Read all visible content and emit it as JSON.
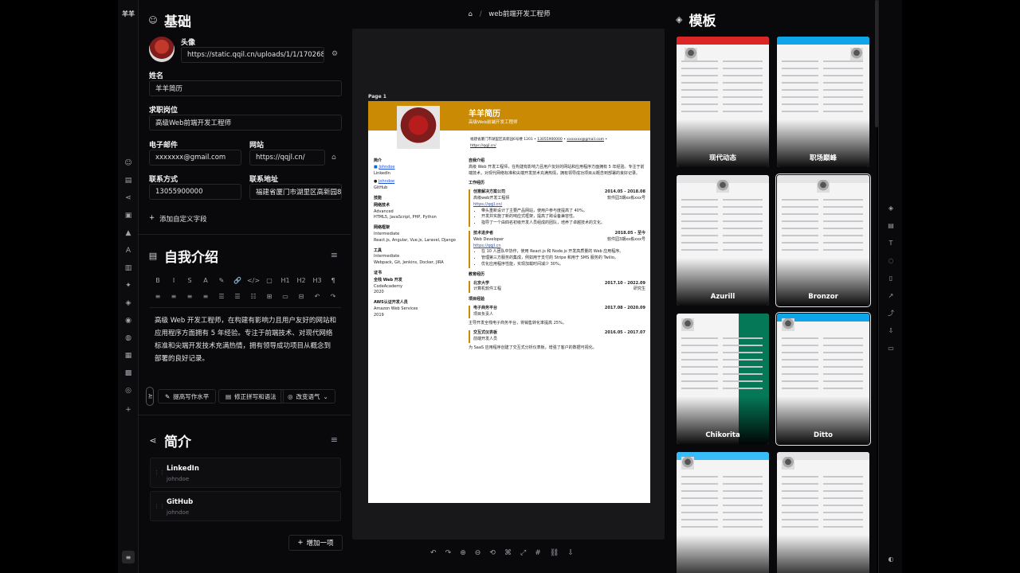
{
  "app": {
    "logo": "羊羊"
  },
  "breadcrumb": {
    "home_icon": "home-icon",
    "title": "web前端开发工程师"
  },
  "basics": {
    "heading": "基础",
    "avatar_label": "头像",
    "avatar_url": "https://static.qqil.cn/uploads/1/1/1702688442",
    "name_label": "姓名",
    "name_value": "羊羊简历",
    "headline_label": "求职岗位",
    "headline_value": "高级Web前端开发工程师",
    "email_label": "电子邮件",
    "email_value": "xxxxxxx@gmail.com",
    "website_label": "网站",
    "website_value": "https://qqjl.cn/",
    "phone_label": "联系方式",
    "phone_value": "13055900000",
    "address_label": "联系地址",
    "address_value": "福建省厦门市湖里区高新园84",
    "add_field": "添加自定义字段"
  },
  "summary": {
    "heading": "自我介绍",
    "text": "高级 Web 开发工程师，在构建有影响力且用户友好的网站和应用程序方面拥有 5 年经验。专注于前端技术、对现代网络标准和尖端开发技术充满热情，拥有领导成功项目从概念到部署的良好记录。",
    "toolbar_row1": [
      "B",
      "I",
      "S",
      "A",
      "✎",
      "🔗",
      "</>",
      "▢",
      "H1",
      "H2",
      "H3",
      "¶"
    ],
    "toolbar_row2": [
      "≡",
      "≡",
      "≡",
      "≡",
      "☰",
      "☰",
      "☷",
      "⊞",
      "▭",
      "⊟",
      "↶",
      "↷"
    ],
    "ai_tag": "AI",
    "ai_buttons": [
      "提高写作水平",
      "修正拼写和语法",
      "改变语气"
    ]
  },
  "profiles": {
    "heading": "简介",
    "items": [
      {
        "network": "LinkedIn",
        "username": "johndoe"
      },
      {
        "network": "GitHub",
        "username": "johndoe"
      }
    ],
    "add_button": "增加一项"
  },
  "resume": {
    "page_label": "Page 1",
    "name": "羊羊简历",
    "title": "高级Web前端开发工程师",
    "contact": [
      "福建省厦门市湖里区高新园6号楼 1201",
      "13055900000",
      "xxxxxxx@gmail.com",
      "https://qqjl.cn/"
    ],
    "left": {
      "profiles_h": "简介",
      "p1_name": "Johndoe",
      "p1_net": "LinkedIn",
      "p2_name": "Johndoe",
      "p2_net": "GitHub",
      "skills_h": "技能",
      "s1": "网络技术",
      "s1_lvl": "Advanced",
      "s1_kw": "HTML5, JavaScript, PHP, Python",
      "s2": "网络框架",
      "s2_lvl": "Intermediate",
      "s2_kw": "React.js, Angular, Vue.js, Laravel, Django",
      "s3": "工具",
      "s3_lvl": "Intermediate",
      "s3_kw": "Webpack, Git, Jenkins, Docker, JIRA",
      "cert_h": "证书",
      "c1": "全栈 Web 开发",
      "c1_org": "CodeAcademy",
      "c1_year": "2020",
      "c2": "AWS认证开发人员",
      "c2_org": "Amazon Web Services",
      "c2_year": "2019"
    },
    "right": {
      "summary_h": "自我介绍",
      "summary": "高级 Web 开发工程师，在构建有影响力且用户友好的网站和应用程序方面拥有 5 年经验。专注于前端技术，对现代网络标准和尖端开发技术充满热情，拥有领导成功项目从概念到部署的良好记录。",
      "work_h": "工作经历",
      "j1_company": "创意解决方案公司",
      "j1_date": "2014.05 - 2018.08",
      "j1_role": "高级web开发工程师",
      "j1_loc": "软件园3期xx栋xxx号",
      "j1_url": "https://qqjl.cn/",
      "j1_b1": "带头重新设计了主要产品网站，使用户参与度提高了 40%。",
      "j1_b2": "开发并实施了新的响应式框架，提高了跨设备兼容性。",
      "j1_b3": "指导了一个由四名初级开发人员组成的团队，培养了卓越技术的文化。",
      "j2_company": "技术进步者",
      "j2_date": "2018.05 - 至今",
      "j2_role": "Web Developer",
      "j2_loc": "软件园3期xx栋xxx号",
      "j2_url": "https://qqjl.cn",
      "j2_b1": "在 10 人团队中协作，使用 React.js 和 Node.js 开发高质量的 Web 应用程序。",
      "j2_b2": "管理第三方服务的集成，例如用于支付的 Stripe 和用于 SMS 服务的 Twilio。",
      "j2_b3": "优化应用程序性能，实现加载时间减少 30%。",
      "edu_h": "教育经历",
      "e1_school": "北京大学",
      "e1_date": "2017.10 - 2022.09",
      "e1_major": "计算机软件工程",
      "e1_deg": "研究生",
      "proj_h": "项目经验",
      "p1_name": "电子商务平台",
      "p1_date": "2017.08 - 2020.09",
      "p1_role": "项目负责人",
      "p1_desc": "主导开发全栈电子商务平台，将销售转化率提高 25%。",
      "p2_name": "交互式仪表板",
      "p2_date": "2016.05 - 2017.07",
      "p2_role": "前端开发人员",
      "p2_desc": "为 SaaS 应用程序创建了交互式分析仪表板，增强了客户的数据可视化。"
    }
  },
  "templates": {
    "heading": "模板",
    "items": [
      "现代动态",
      "职场巅峰",
      "Azurill",
      "Bronzor",
      "Chikorita",
      "Ditto",
      "",
      ""
    ]
  },
  "colors": {
    "accent": "#ca8a04",
    "bg": "#09090b",
    "border": "#27272a"
  }
}
